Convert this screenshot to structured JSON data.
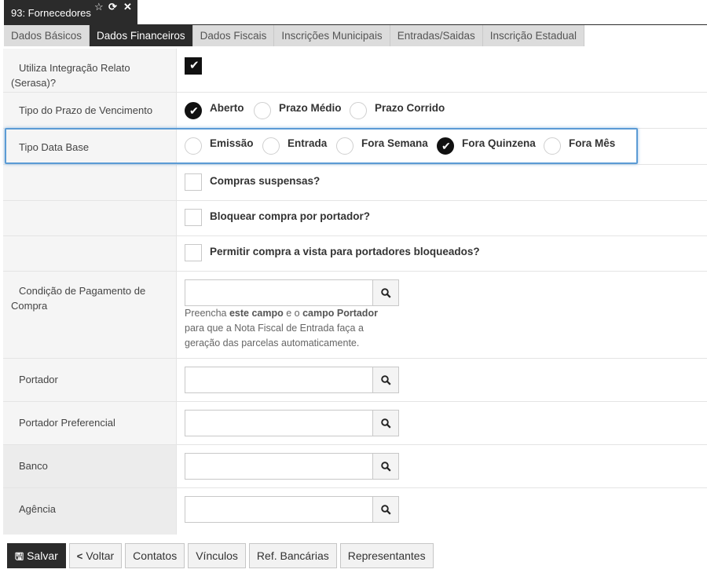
{
  "window": {
    "title": "93: Fornecedores",
    "icons": [
      "star-icon",
      "refresh-icon",
      "close-icon"
    ]
  },
  "tabs": [
    {
      "label": "Dados Básicos",
      "active": false
    },
    {
      "label": "Dados Financeiros",
      "active": true
    },
    {
      "label": "Dados Fiscais",
      "active": false
    },
    {
      "label": "Inscrições Municipais",
      "active": false
    },
    {
      "label": "Entradas/Saidas",
      "active": false
    },
    {
      "label": "Inscrição Estadual",
      "active": false
    }
  ],
  "form": {
    "serasa": {
      "label1": "Utiliza Integração Relato",
      "label2": "(Serasa)?",
      "checked": true
    },
    "tipo_prazo": {
      "label": "Tipo do Prazo de Vencimento",
      "options": [
        "Aberto",
        "Prazo Médio",
        "Prazo Corrido"
      ],
      "selected": "Aberto"
    },
    "tipo_data_base": {
      "label": "Tipo Data Base",
      "options": [
        "Emissão",
        "Entrada",
        "Fora Semana",
        "Fora Quinzena",
        "Fora Mês"
      ],
      "selected": "Fora Quinzena"
    },
    "compras_suspensas": {
      "label": "Compras suspensas?",
      "checked": false
    },
    "bloquear_portador": {
      "label": "Bloquear compra por portador?",
      "checked": false
    },
    "permitir_vista": {
      "label": "Permitir compra a vista para portadores bloqueados?",
      "checked": false
    },
    "condicao_pagamento": {
      "label1": "Condição de Pagamento de",
      "label2": "Compra",
      "value": "",
      "help": {
        "p1": "Preencha ",
        "b1": "este campo",
        "p2": " e o ",
        "b2": "campo Portador",
        "line2": "para que a Nota Fiscal de Entrada faça a",
        "line3": "geração das parcelas automaticamente."
      }
    },
    "portador": {
      "label": "Portador",
      "value": ""
    },
    "portador_preferencial": {
      "label": "Portador Preferencial",
      "value": ""
    },
    "banco": {
      "label": "Banco",
      "value": ""
    },
    "agencia": {
      "label": "Agência",
      "value": ""
    }
  },
  "buttons": {
    "salvar": "Salvar",
    "voltar": "Voltar",
    "contatos": "Contatos",
    "vinculos": "Vínculos",
    "ref_bancarias": "Ref. Bancárias",
    "representantes": "Representantes"
  },
  "colors": {
    "dark": "#2b2b2b",
    "highlight": "#5b9bd5",
    "tab_bg": "#dcdcdc"
  }
}
